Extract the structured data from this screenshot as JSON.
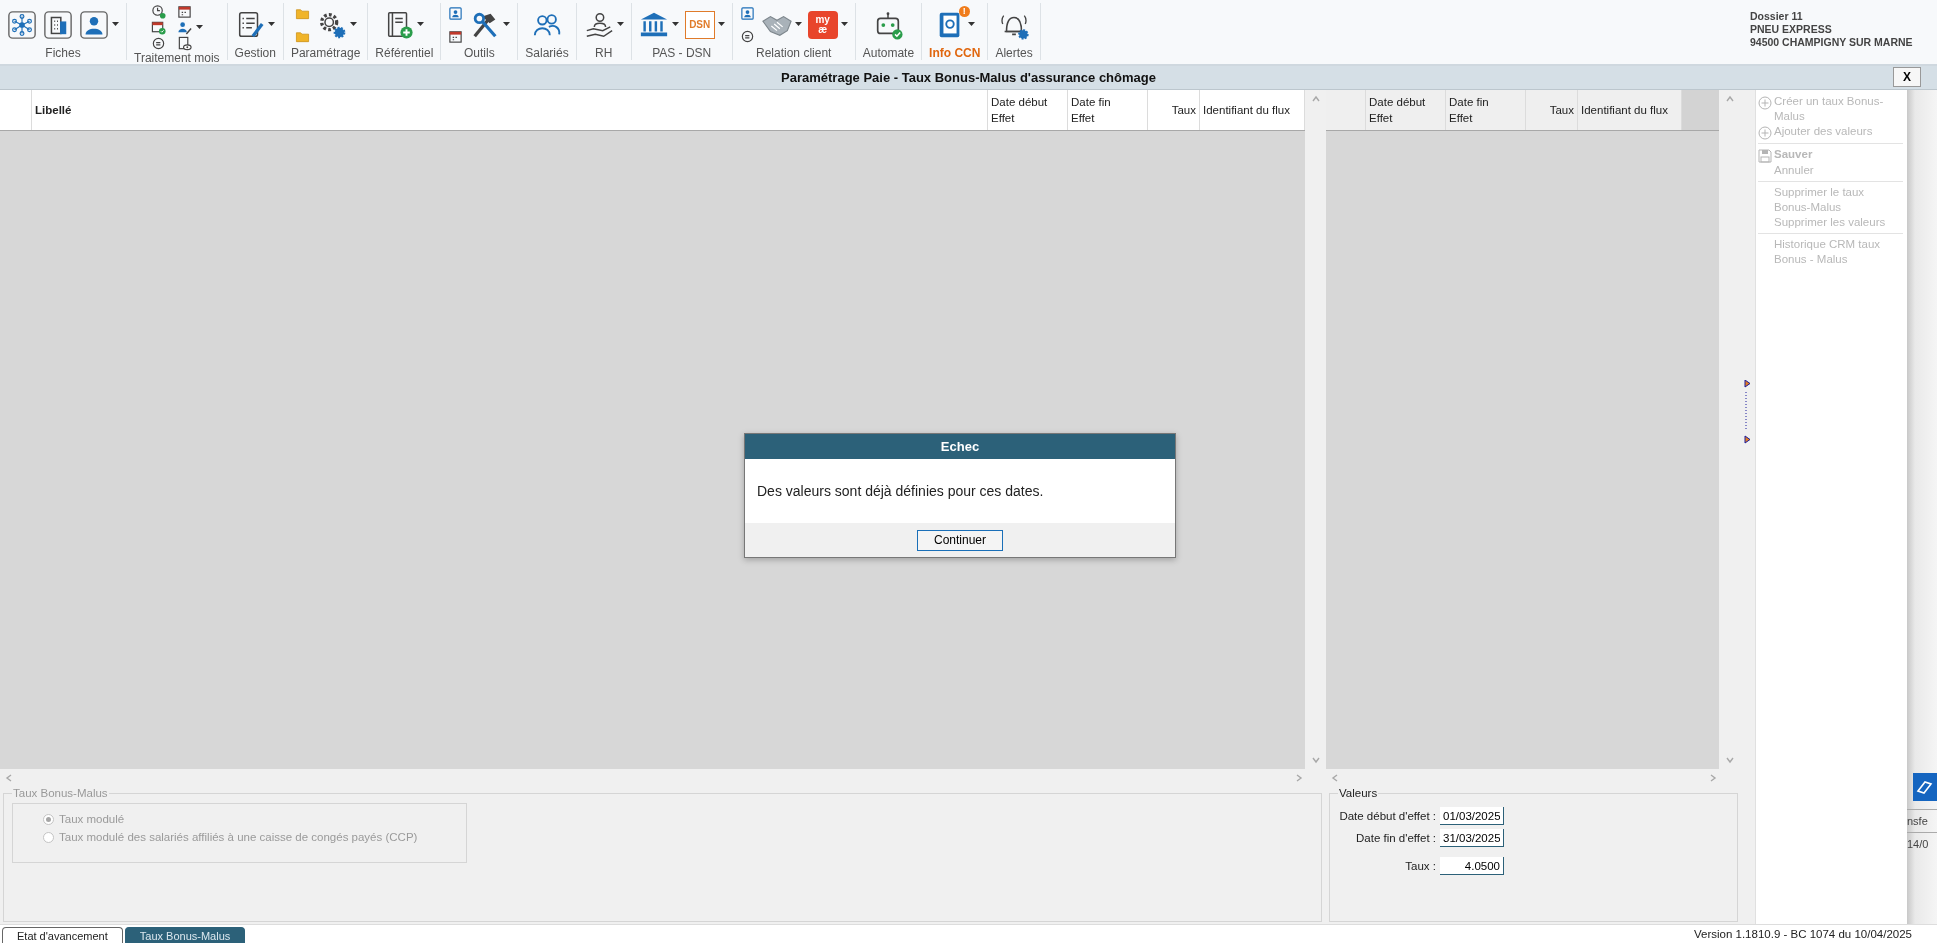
{
  "toolbar": {
    "groups": [
      {
        "label": "Fiches",
        "highlighted": false,
        "items": [
          {
            "dropdown": false
          },
          {
            "dropdown": false
          },
          {
            "dropdown": true
          }
        ]
      },
      {
        "label": "Traitement mois",
        "highlighted": false,
        "items": [
          {
            "dropdown": true
          }
        ]
      },
      {
        "label": "Gestion",
        "highlighted": false,
        "items": [
          {
            "dropdown": true
          }
        ]
      },
      {
        "label": "Paramétrage",
        "highlighted": false,
        "items": [
          {
            "dropdown": false
          },
          {
            "dropdown": true
          }
        ]
      },
      {
        "label": "Référentiel",
        "highlighted": false,
        "items": [
          {
            "dropdown": true
          }
        ]
      },
      {
        "label": "Outils",
        "highlighted": false,
        "items": [
          {
            "dropdown": false
          },
          {
            "dropdown": true
          }
        ]
      },
      {
        "label": "Salariés",
        "highlighted": false,
        "items": [
          {
            "dropdown": false
          }
        ]
      },
      {
        "label": "RH",
        "highlighted": false,
        "items": [
          {
            "dropdown": true
          }
        ]
      },
      {
        "label": "PAS - DSN",
        "highlighted": false,
        "items": [
          {
            "dropdown": true
          },
          {
            "dropdown": true,
            "logo_text": "DSN"
          }
        ]
      },
      {
        "label": "Relation client",
        "highlighted": false,
        "items": [
          {
            "dropdown": false
          },
          {
            "dropdown": true
          },
          {
            "dropdown": true,
            "logo_text": "my æ"
          }
        ]
      },
      {
        "label": "Automate",
        "highlighted": false,
        "items": [
          {
            "dropdown": false
          }
        ]
      },
      {
        "label": "Info CCN",
        "highlighted": true,
        "items": [
          {
            "dropdown": true,
            "notification": "!"
          }
        ]
      },
      {
        "label": "Alertes",
        "highlighted": false,
        "items": [
          {
            "dropdown": false
          }
        ]
      }
    ]
  },
  "dossier": {
    "lines": [
      "Dossier 11",
      "PNEU EXPRESS",
      "94500 CHAMPIGNY SUR MARNE"
    ]
  },
  "window_title": "Paramétrage Paie - Taux Bonus-Malus d'assurance chômage",
  "close_label": "X",
  "main_table": {
    "columns": [
      "Libellé",
      "Date début Effet",
      "Date fin Effet",
      "Taux",
      "Identifiant du flux"
    ]
  },
  "values_table": {
    "columns": [
      "Date début Effet",
      "Date fin Effet",
      "Taux",
      "Identifiant du flux"
    ]
  },
  "actions": [
    {
      "label": "Créer un taux Bonus-Malus",
      "kind": "create",
      "disabled": true,
      "separator_before": false
    },
    {
      "label": "Ajouter des valeurs",
      "kind": "create",
      "disabled": true,
      "separator_before": false
    },
    {
      "label": "Sauver",
      "kind": "save",
      "disabled": true,
      "separator_before": true
    },
    {
      "label": "Annuler",
      "kind": "plain",
      "disabled": true,
      "separator_before": false
    },
    {
      "label": "Supprimer le taux Bonus-Malus",
      "kind": "plain",
      "disabled": true,
      "separator_before": true
    },
    {
      "label": "Supprimer les valeurs",
      "kind": "plain",
      "disabled": true,
      "separator_before": false
    },
    {
      "label": "Historique CRM taux Bonus - Malus",
      "kind": "plain",
      "disabled": true,
      "separator_before": true
    }
  ],
  "rate_type": {
    "legend": "Taux Bonus-Malus",
    "disabled": true,
    "options": [
      {
        "label": "Taux modulé",
        "selected": true
      },
      {
        "label": "Taux modulé des salariés affiliés à une caisse de congés payés (CCP)",
        "selected": false
      }
    ]
  },
  "values": {
    "legend": "Valeurs",
    "fields": [
      {
        "label": "Date début d'effet :",
        "value": "01/03/2025",
        "kind": "date"
      },
      {
        "label": "Date fin d'effet :",
        "value": "31/03/2025",
        "kind": "date"
      },
      {
        "label": "Taux :",
        "value": "4.0500",
        "kind": "number"
      }
    ]
  },
  "dialog": {
    "title": "Echec",
    "message": "Des valeurs sont déjà définies pour ces dates.",
    "button": "Continuer"
  },
  "tabs": [
    {
      "label": "Etat d'avancement",
      "selected": false
    },
    {
      "label": "Taux Bonus-Malus",
      "selected": true
    }
  ],
  "status": "Version 1.1810.9 - BC 1074 du 10/04/2025",
  "background_window": {
    "texts": [
      "nsfe",
      "14/0"
    ]
  }
}
